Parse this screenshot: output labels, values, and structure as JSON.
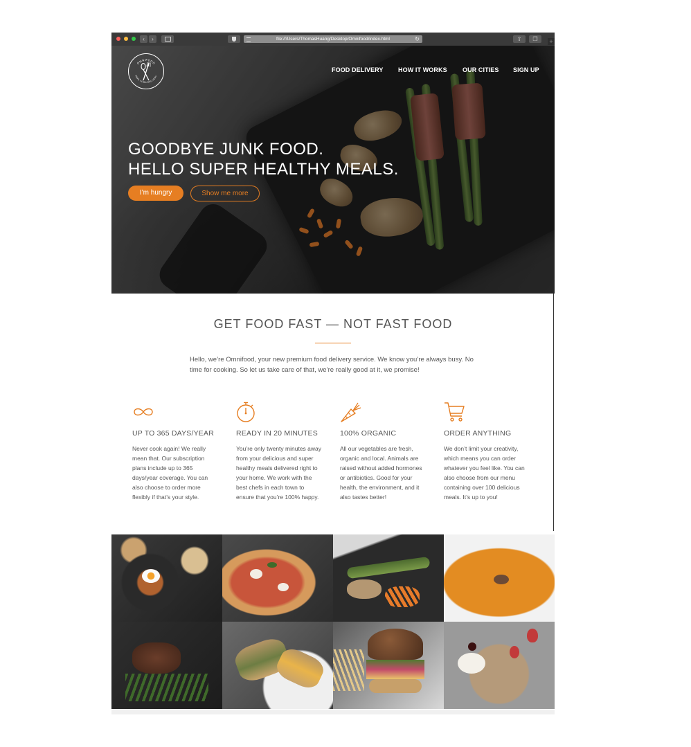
{
  "browser": {
    "url": "file:///Users/ThomasHuang/Desktop/Omnifood/index.html",
    "nav_back": "‹",
    "nav_forward": "›",
    "share_icon": "share-icon",
    "tabs_icon": "tabs-icon",
    "new_tab": "+"
  },
  "brand": {
    "accent": "#e67e22",
    "logo_top_text": "OMNIFOOD",
    "logo_bottom_text": "REAL FOOD DELIVERY"
  },
  "nav": {
    "items": [
      {
        "label": "Food delivery"
      },
      {
        "label": "How it works"
      },
      {
        "label": "Our cities"
      },
      {
        "label": "Sign up"
      }
    ]
  },
  "hero": {
    "title_line1": "Goodbye junk food.",
    "title_line2": "Hello super healthy meals.",
    "btn_primary": "I’m hungry",
    "btn_secondary": "Show me more"
  },
  "features": {
    "title": "Get food fast — not fast food",
    "intro": "Hello, we’re Omnifood, your new premium food delivery service. We know you’re always busy. No time for cooking. So let us take care of that, we’re really good at it, we promise!",
    "items": [
      {
        "icon": "infinity-icon",
        "title": "Up to 365 days/year",
        "text": "Never cook again! We really mean that. Our subscription plans include up to 365 days/year coverage. You can also choose to order more flexibly if that’s your style."
      },
      {
        "icon": "stopwatch-icon",
        "title": "Ready in 20 minutes",
        "text": "You’re only twenty minutes away from your delicious and super healthy meals delivered right to your home. We work with the best chefs in each town to ensure that you’re 100% happy."
      },
      {
        "icon": "carrot-icon",
        "title": "100% organic",
        "text": "All our vegetables are fresh, organic and local. Animals are raised without added hormones or antibiotics. Good for your health, the environment, and it also tastes better!"
      },
      {
        "icon": "cart-icon",
        "title": "Order anything",
        "text": "We don’t limit your creativity, which means you can order whatever you feel like. You can also choose from our menu containing over 100 delicious meals. It’s up to you!"
      }
    ]
  },
  "gallery": {
    "items": [
      {
        "name": "bibimbap-photo"
      },
      {
        "name": "pizza-photo"
      },
      {
        "name": "chicken-asparagus-photo"
      },
      {
        "name": "pumpkin-soup-photo"
      },
      {
        "name": "steak-beans-photo"
      },
      {
        "name": "sandwich-photo"
      },
      {
        "name": "burger-photo"
      },
      {
        "name": "granola-berries-photo"
      }
    ]
  }
}
